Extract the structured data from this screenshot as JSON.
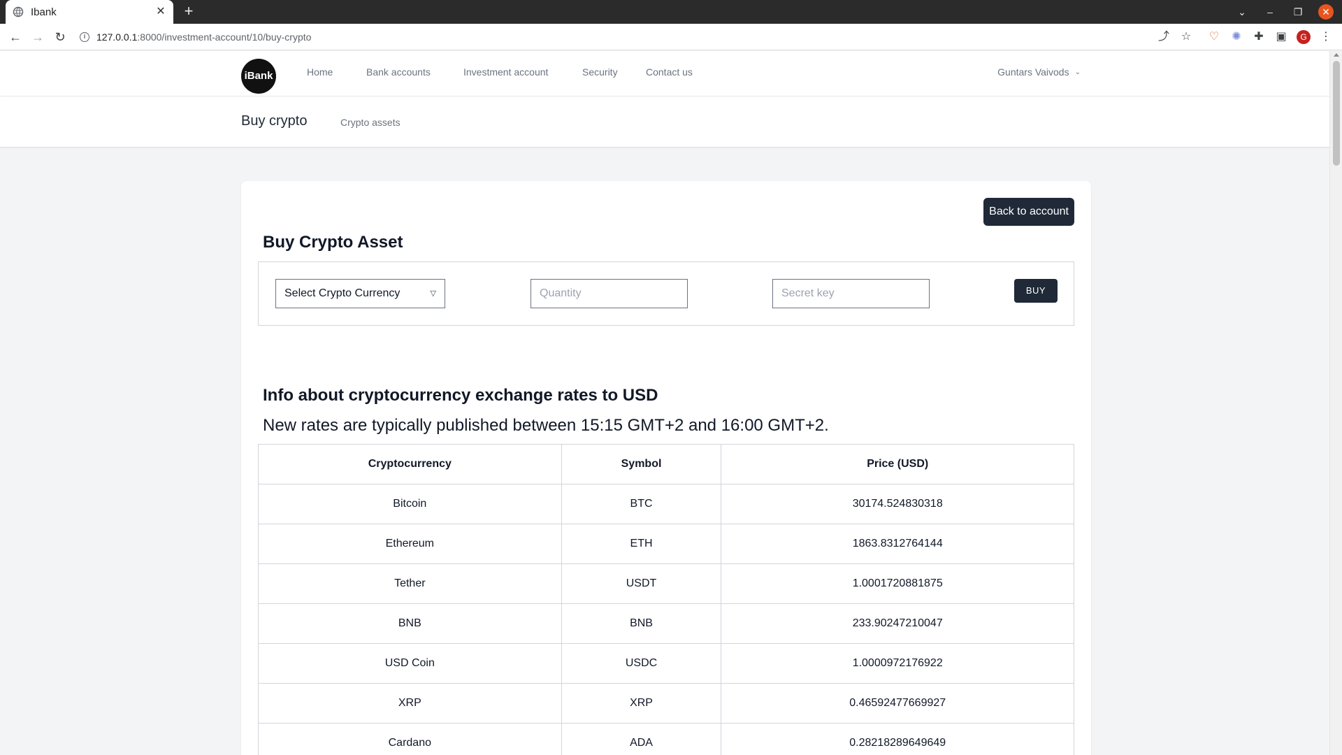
{
  "browser": {
    "tab_title": "Ibank",
    "url_host": "127.0.0.1",
    "url_rest": ":8000/investment-account/10/buy-crypto",
    "profile_initial": "G"
  },
  "nav": {
    "logo": "iBank",
    "links": [
      "Home",
      "Bank accounts",
      "Investment account",
      "Security",
      "Contact us"
    ],
    "user": "Guntars Vaivods"
  },
  "subheader": {
    "title": "Buy crypto",
    "link": "Crypto assets"
  },
  "form": {
    "back_label": "Back to account",
    "heading": "Buy Crypto Asset",
    "select_value": "Select Crypto Currency",
    "quantity_placeholder": "Quantity",
    "secret_placeholder": "Secret key",
    "buy_label": "BUY"
  },
  "rates": {
    "title": "Info about cryptocurrency exchange rates to USD",
    "subtitle": "New rates are typically published between 15:15 GMT+2 and 16:00 GMT+2.",
    "headers": [
      "Cryptocurrency",
      "Symbol",
      "Price (USD)"
    ],
    "rows": [
      [
        "Bitcoin",
        "BTC",
        "30174.524830318"
      ],
      [
        "Ethereum",
        "ETH",
        "1863.8312764144"
      ],
      [
        "Tether",
        "USDT",
        "1.0001720881875"
      ],
      [
        "BNB",
        "BNB",
        "233.90247210047"
      ],
      [
        "USD Coin",
        "USDC",
        "1.0000972176922"
      ],
      [
        "XRP",
        "XRP",
        "0.46592477669927"
      ],
      [
        "Cardano",
        "ADA",
        "0.28218289649649"
      ]
    ]
  },
  "colors": {
    "accent_dark": "#1f2937",
    "page_bg": "#f3f4f6"
  }
}
